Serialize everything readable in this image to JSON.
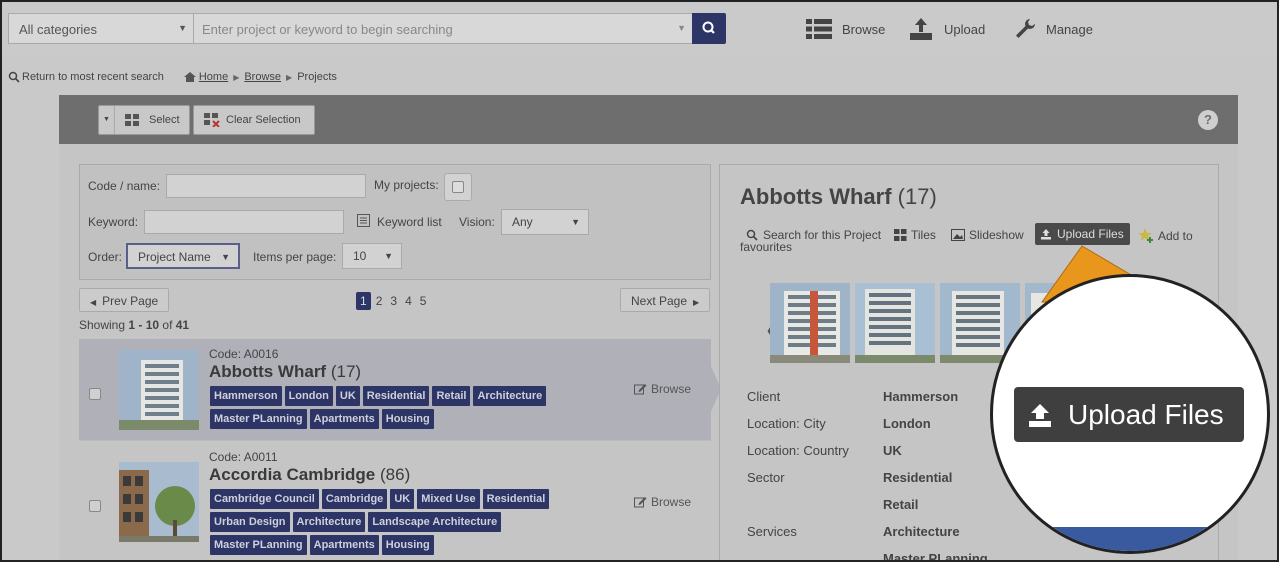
{
  "header": {
    "category_select": "All categories",
    "search_placeholder": "Enter project or keyword to begin searching",
    "nav": {
      "browse": "Browse",
      "upload": "Upload",
      "manage": "Manage"
    }
  },
  "breadcrumb": {
    "return": "Return to most recent search",
    "home": "Home",
    "browse": "Browse",
    "current": "Projects"
  },
  "toolbar": {
    "select": "Select",
    "clear_selection": "Clear Selection",
    "help": "?"
  },
  "filter": {
    "code_label": "Code / name:",
    "my_projects_label": "My projects:",
    "keyword_label": "Keyword:",
    "keyword_list": "Keyword list",
    "vision_label": "Vision:",
    "vision_value": "Any",
    "order_label": "Order:",
    "order_value": "Project Name",
    "ipp_label": "Items per page:",
    "ipp_value": "10"
  },
  "pagination": {
    "prev": "Prev Page",
    "next": "Next Page",
    "pages": [
      "1",
      "2",
      "3",
      "4",
      "5"
    ],
    "showing_prefix": "Showing ",
    "showing_range": "1 - 10",
    "showing_of": " of ",
    "showing_total": "41"
  },
  "projects": [
    {
      "code": "Code: A0016",
      "name": "Abbotts Wharf",
      "count": "(17)",
      "tags": [
        "Hammerson",
        "London",
        "UK",
        "Residential",
        "Retail",
        "Architecture",
        "Master PLanning",
        "Apartments",
        "Housing"
      ],
      "browse": "Browse"
    },
    {
      "code": "Code: A0011",
      "name": "Accordia Cambridge",
      "count": "(86)",
      "tags": [
        "Cambridge Council",
        "Cambridge",
        "UK",
        "Mixed Use",
        "Residential",
        "Urban Design",
        "Architecture",
        "Landscape Architecture",
        "Master PLanning",
        "Apartments",
        "Housing"
      ],
      "browse": "Browse"
    }
  ],
  "detail": {
    "title": "Abbotts Wharf",
    "count": "(17)",
    "actions": {
      "search": "Search for this Project",
      "tiles": "Tiles",
      "slideshow": "Slideshow",
      "upload": "Upload Files",
      "favourites_a": "Add to",
      "favourites_b": "favourites"
    },
    "carousel_prev": "〈",
    "fields": [
      {
        "label": "Client",
        "value": "Hammerson"
      },
      {
        "label": "Location: City",
        "value": "London"
      },
      {
        "label": "Location: Country",
        "value": "UK"
      },
      {
        "label": "Sector",
        "value": "Residential"
      },
      {
        "label": "",
        "value": "Retail"
      },
      {
        "label": "Services",
        "value": "Architecture"
      },
      {
        "label": "",
        "value": "Master PLanning"
      }
    ]
  },
  "callout": {
    "label": "Upload Files"
  },
  "colors": {
    "accent": "#2c3566",
    "callout": "#e8961c"
  }
}
